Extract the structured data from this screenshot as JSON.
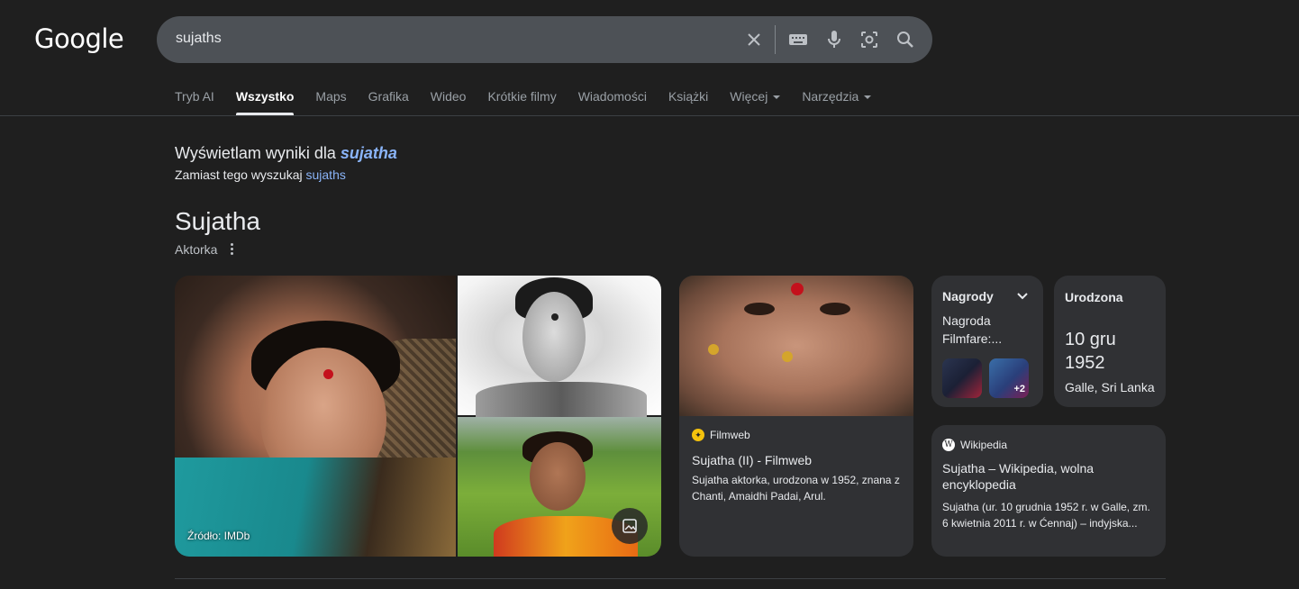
{
  "header": {
    "logo": "Google",
    "search_value": "sujaths"
  },
  "tabs": [
    {
      "label": "Tryb AI"
    },
    {
      "label": "Wszystko"
    },
    {
      "label": "Maps"
    },
    {
      "label": "Grafika"
    },
    {
      "label": "Wideo"
    },
    {
      "label": "Krótkie filmy"
    },
    {
      "label": "Wiadomości"
    },
    {
      "label": "Książki"
    },
    {
      "label": "Więcej"
    },
    {
      "label": "Narzędzia"
    }
  ],
  "correction": {
    "showing_prefix": "Wyświetlam wyniki dla",
    "corrected_query": "sujatha",
    "instead_prefix": "Zamiast tego wyszukaj",
    "original_query": "sujaths"
  },
  "entity": {
    "title": "Sujatha",
    "subtitle": "Aktorka",
    "image_source": "Źródło: IMDb"
  },
  "filmweb": {
    "source": "Filmweb",
    "title": "Sujatha (II) - Filmweb",
    "description": "Sujatha aktorka, urodzona w 1952, znana z Chanti, Amaidhi Padai, Arul."
  },
  "awards": {
    "heading": "Nagrody",
    "text": "Nagroda Filmfare:...",
    "more": "+2"
  },
  "born": {
    "heading": "Urodzona",
    "date": "10 gru 1952",
    "place": "Galle, Sri Lanka"
  },
  "wikipedia": {
    "source": "Wikipedia",
    "title": "Sujatha – Wikipedia, wolna encyklopedia",
    "description": "Sujatha (ur. 10 grudnia 1952 r. w Galle, zm. 6 kwietnia 2011 r. w Ćennaj) – indyjska..."
  }
}
